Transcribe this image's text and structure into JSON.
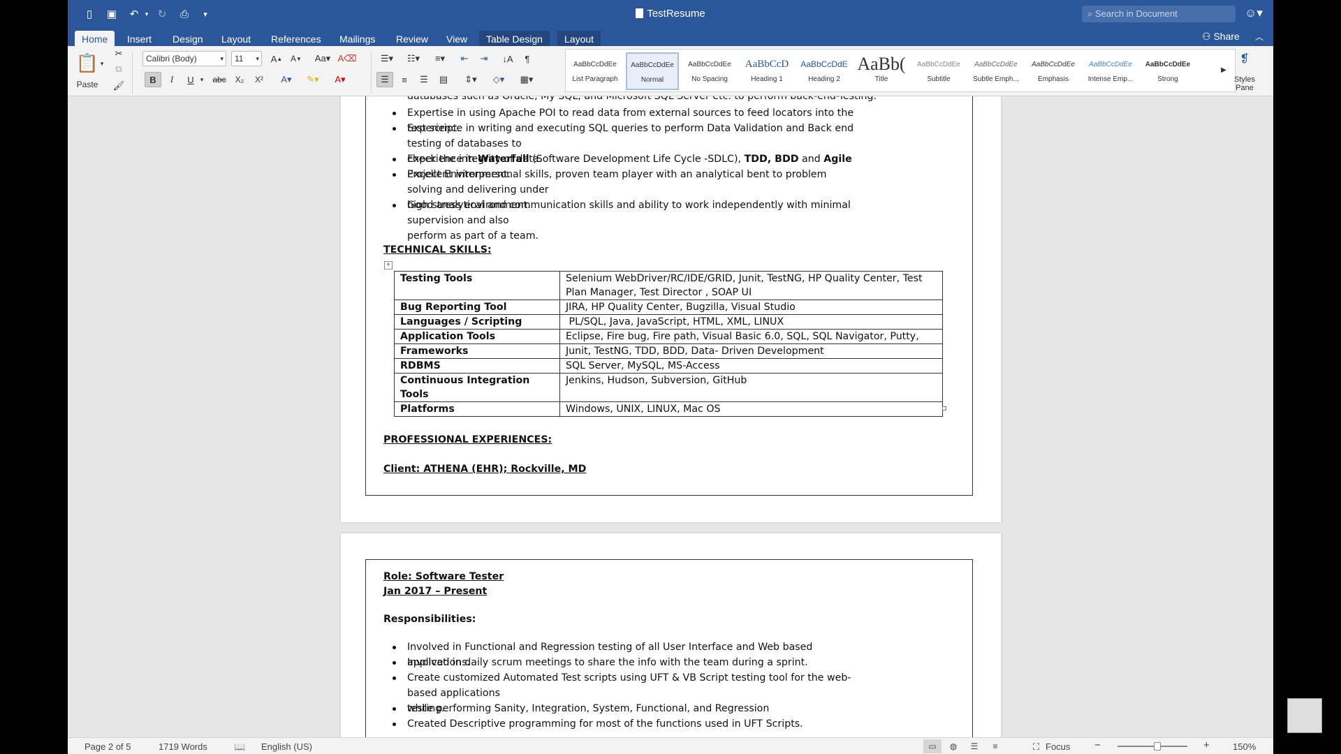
{
  "window": {
    "title": "TestResume",
    "search_placeholder": "Search in Document"
  },
  "tabs": [
    "Home",
    "Insert",
    "Design",
    "Layout",
    "References",
    "Mailings",
    "Review",
    "View",
    "Table Design",
    "Layout"
  ],
  "share_label": "Share",
  "ribbon": {
    "paste_label": "Paste",
    "font_name": "Calibri (Body)",
    "font_size": "11",
    "styles_pane_label": "Styles Pane",
    "styles": [
      {
        "preview": "AaBbCcDdEe",
        "name": "List Paragraph"
      },
      {
        "preview": "AaBbCcDdEe",
        "name": "Normal"
      },
      {
        "preview": "AaBbCcDdEe",
        "name": "No Spacing"
      },
      {
        "preview": "AaBbCcD",
        "name": "Heading 1"
      },
      {
        "preview": "AaBbCcDdE",
        "name": "Heading 2"
      },
      {
        "preview": "AaBb(",
        "name": "Title"
      },
      {
        "preview": "AaBbCcDdEe",
        "name": "Subtitle"
      },
      {
        "preview": "AaBbCcDdEe",
        "name": "Subtle Emph..."
      },
      {
        "preview": "AaBbCcDdEe",
        "name": "Emphasis"
      },
      {
        "preview": "AaBbCcDdEe",
        "name": "Intense Emp..."
      },
      {
        "preview": "AaBbCcDdEe",
        "name": "Strong"
      }
    ]
  },
  "page1": {
    "partial_line": "databases such as Oracle, My SQL, and Microsoft SQL Server etc. to perform back-end-Testing.",
    "bullets": [
      {
        "lines": [
          "Expertise in using Apache POI to read data from external sources to feed locators into the test script."
        ]
      },
      {
        "lines": [
          "Experience in writing and executing SQL queries to perform Data Validation and Back end testing of databases to",
          "check the integrity of data."
        ]
      },
      {
        "a": "Experience in ",
        "b1": "Waterfall",
        "c": " (Software Development Life Cycle -SDLC), ",
        "b2": "TDD, BDD",
        "d": " and ",
        "b3": "Agile",
        "e": " Project Environment."
      },
      {
        "lines": [
          "Excellent interpersonal skills, proven team player with an analytical bent to problem solving and delivering under",
          "high stress environment."
        ]
      },
      {
        "lines": [
          "Good analytical and communication skills and ability to work independently with minimal supervision and also",
          "perform as part of a team."
        ]
      }
    ],
    "technical_heading": "TECHNICAL SKILLS:",
    "skills": [
      {
        "label": "Testing Tools",
        "value": "Selenium WebDriver/RC/IDE/GRID, Junit, TestNG, HP Quality Center, Test",
        "value2": "Plan Manager, Test Director , SOAP UI"
      },
      {
        "label": "Bug Reporting Tool",
        "value": "JIRA, HP Quality Center, Bugzilla, Visual Studio"
      },
      {
        "label": "Languages / Scripting",
        "value": " PL/SQL, Java, JavaScript, HTML, XML, LINUX"
      },
      {
        "label": "Application Tools",
        "value": "Eclipse, Fire bug, Fire path, Visual Basic 6.0, SQL, SQL Navigator, Putty,"
      },
      {
        "label": "Frameworks",
        "value": "Junit, TestNG, TDD, BDD, Data- Driven Development"
      },
      {
        "label": "RDBMS",
        "value": "SQL Server, MySQL, MS-Access"
      },
      {
        "label": "Continuous Integration Tools",
        "value": "Jenkins, Hudson, Subversion, GitHub"
      },
      {
        "label": "Platforms",
        "value": "Windows, UNIX, LINUX, Mac OS"
      }
    ],
    "experience_heading": "PROFESSIONAL EXPERIENCES:",
    "client": "Client: ATHENA (EHR); Rockville, MD"
  },
  "page2": {
    "role": "Role: Software Tester",
    "dates": "Jan 2017 – Present",
    "responsibilities": "Responsibilities:",
    "bullets": [
      [
        "Involved in Functional and Regression testing of all User Interface and Web based applications."
      ],
      [
        "Involved in daily scrum meetings to share the info with the team during a sprint."
      ],
      [
        "Create customized Automated Test scripts using UFT & VB Script testing tool for the web-based applications",
        "while performing Sanity, Integration, System, Functional, and Regression"
      ],
      [
        "testing."
      ],
      [
        "Created Descriptive programming for most of the functions used in UFT Scripts."
      ]
    ]
  },
  "status": {
    "page": "Page 2 of 5",
    "words": "1719 Words",
    "language": "English (US)",
    "focus": "Focus",
    "zoom": "150%"
  }
}
